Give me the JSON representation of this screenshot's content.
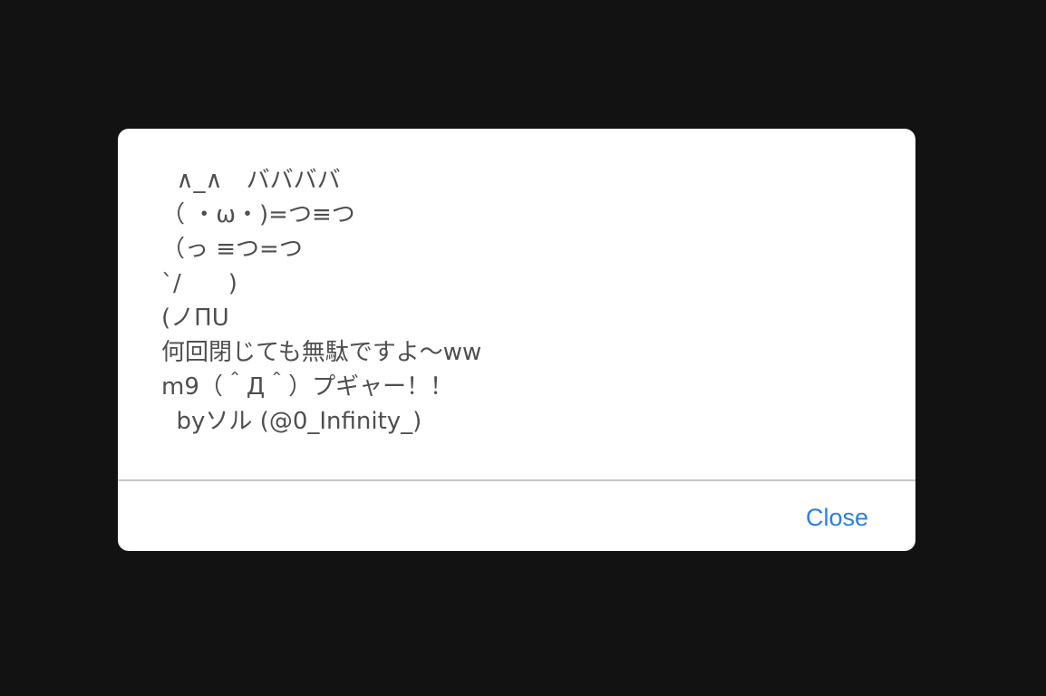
{
  "dialog": {
    "message_lines": [
      "  ∧_∧　ババババ",
      "（ ・ω・)=つ≡つ",
      "（っ ≡つ=つ",
      "`/　　)",
      "(ノΠU",
      "何回閉じても無駄ですよ～ww",
      "m9（＾Д＾）プギャー！！",
      "  byソル (@0_Infinity_)"
    ],
    "close_label": "Close"
  },
  "colors": {
    "backdrop": "#121212",
    "dialog_background": "#ffffff",
    "message_text": "#4f4f4f",
    "accent": "#2f7de1",
    "divider": "#c8c8c8"
  }
}
